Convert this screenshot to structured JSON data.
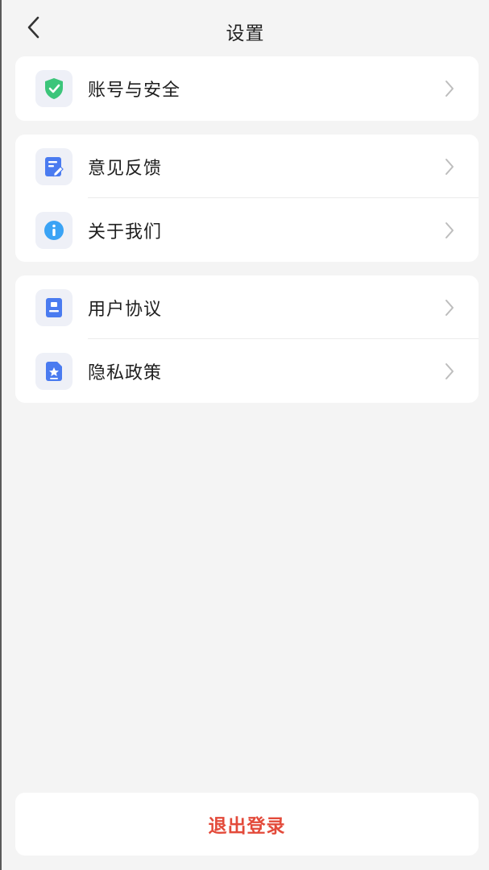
{
  "header": {
    "title": "设置",
    "back_icon": "chevron-left-icon"
  },
  "groups": [
    {
      "items": [
        {
          "label": "账号与安全",
          "icon": "shield-check-icon",
          "icon_color": "#3cc57a"
        }
      ]
    },
    {
      "items": [
        {
          "label": "意见反馈",
          "icon": "feedback-edit-icon",
          "icon_color": "#4a7bf0"
        },
        {
          "label": "关于我们",
          "icon": "info-icon",
          "icon_color": "#3aa3f5"
        }
      ]
    },
    {
      "items": [
        {
          "label": "用户协议",
          "icon": "user-agreement-icon",
          "icon_color": "#4a7bf0"
        },
        {
          "label": "隐私政策",
          "icon": "privacy-policy-icon",
          "icon_color": "#4a7bf0"
        }
      ]
    }
  ],
  "logout": {
    "label": "退出登录",
    "color": "#e34a3a"
  },
  "colors": {
    "background": "#f4f4f4",
    "card": "#ffffff",
    "chevron": "#bdbdbd"
  }
}
